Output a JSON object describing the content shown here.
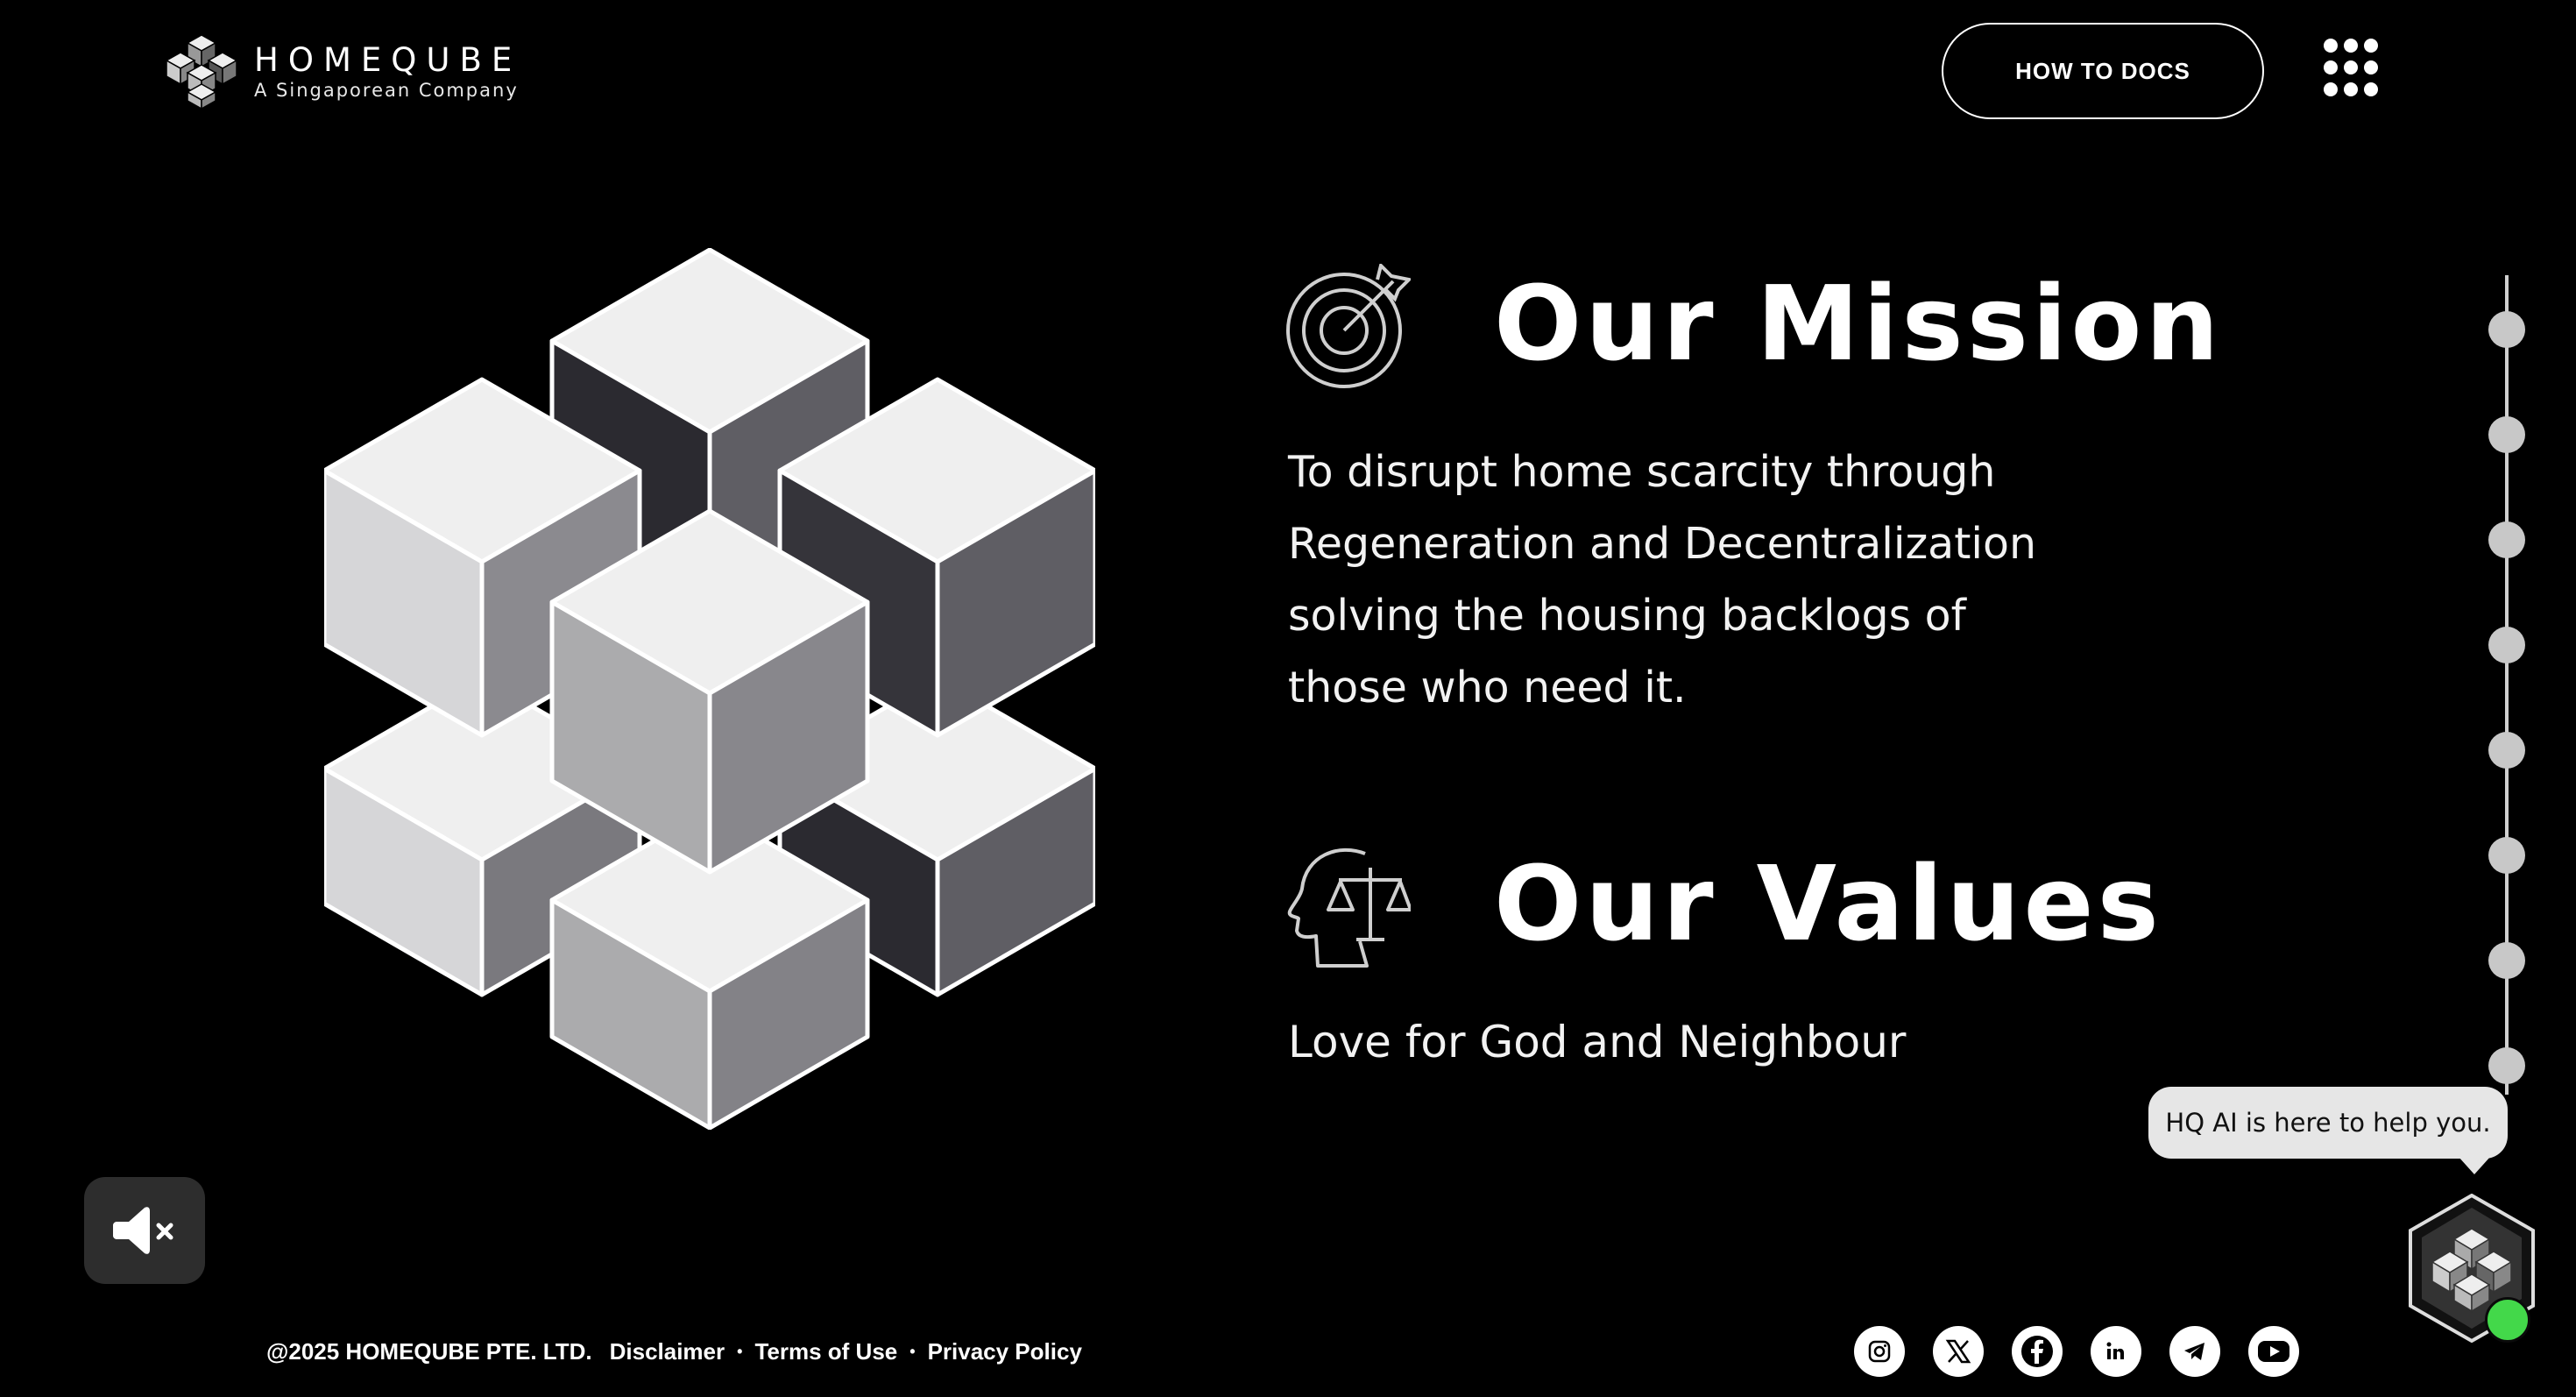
{
  "header": {
    "brand_name": "HOMEQUBE",
    "brand_tagline": "A Singaporean Company",
    "docs_button": "HOW TO DOCS"
  },
  "mission": {
    "title": "Our Mission",
    "body": "To disrupt home scarcity through Regeneration and Decentralization solving the housing backlogs of those who need it."
  },
  "values": {
    "title": "Our Values",
    "body": "Love for God and Neighbour"
  },
  "chat": {
    "message": "HQ AI is here to help you."
  },
  "footer": {
    "copyright": "@2025 HOMEQUBE PTE. LTD.",
    "links": [
      "Disclaimer",
      "Terms of Use",
      "Privacy Policy"
    ],
    "separator": "•"
  },
  "socials": [
    "instagram-icon",
    "x-icon",
    "facebook-icon",
    "linkedin-icon",
    "telegram-icon",
    "youtube-icon"
  ],
  "colors": {
    "background": "#000000",
    "accent_online": "#43d84a",
    "chat_bubble": "#e6e6e6",
    "timeline": "#c8c8c8"
  }
}
